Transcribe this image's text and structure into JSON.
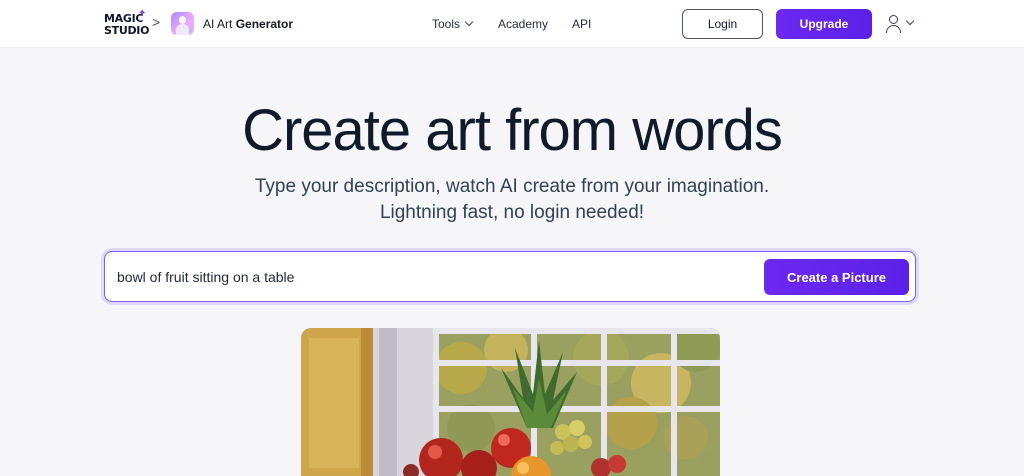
{
  "header": {
    "logo_line1": "MAGIC",
    "logo_line2": "STUDIO",
    "breadcrumb_separator": ">",
    "app_name_prefix": "AI Art",
    "app_name_bold": "Generator",
    "nav": {
      "tools_label": "Tools",
      "academy_label": "Academy",
      "api_label": "API"
    },
    "login_label": "Login",
    "upgrade_label": "Upgrade",
    "icons": [
      "sparkle-icon",
      "chevron-right-icon",
      "app-avatar-icon",
      "chevron-down-icon",
      "user-icon"
    ]
  },
  "hero": {
    "title": "Create art from words",
    "subtitle_line1": "Type your description, watch AI create from your imagination.",
    "subtitle_line2": "Lightning fast, no login needed!"
  },
  "prompt": {
    "value": "bowl of fruit sitting on a table",
    "button_label": "Create a Picture"
  },
  "colors": {
    "accent": "#6d28f2",
    "background": "#f6f6f8",
    "text": "#0f1a2b"
  }
}
